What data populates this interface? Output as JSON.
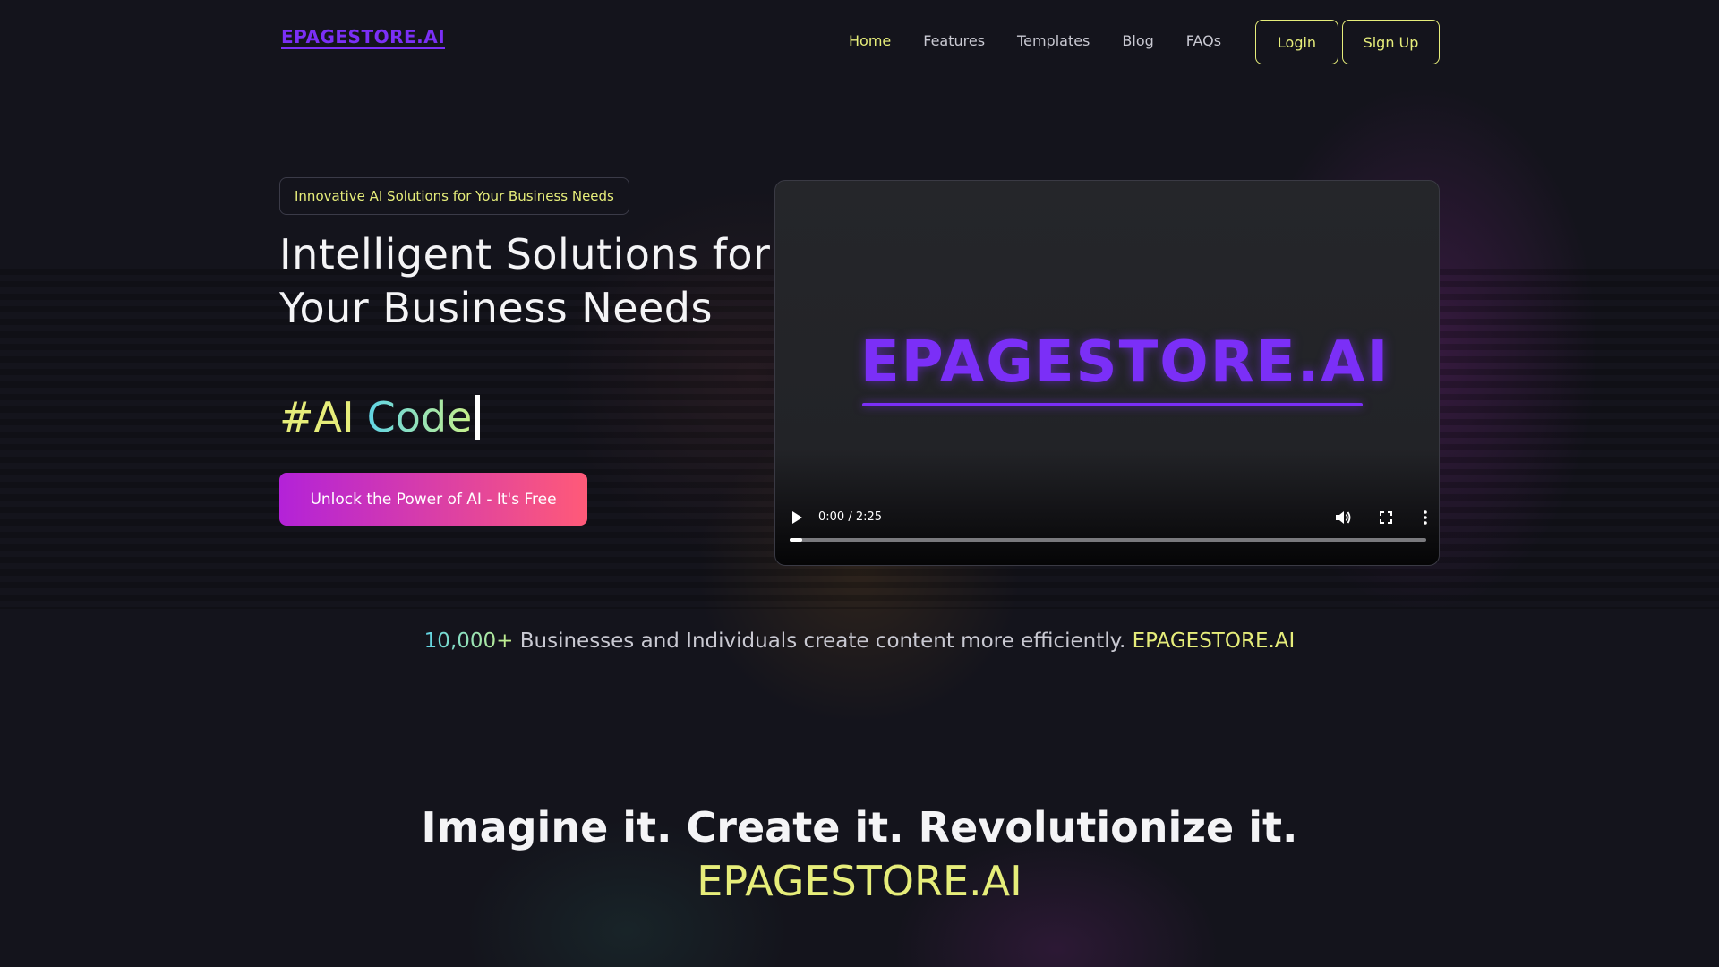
{
  "header": {
    "logo": "EPAGESTORE.AI",
    "nav": [
      {
        "label": "Home",
        "active": true
      },
      {
        "label": "Features",
        "active": false
      },
      {
        "label": "Templates",
        "active": false
      },
      {
        "label": "Blog",
        "active": false
      },
      {
        "label": "FAQs",
        "active": false
      }
    ],
    "login_label": "Login",
    "signup_label": "Sign Up"
  },
  "hero": {
    "tagline": "Innovative AI Solutions for Your Business Needs",
    "headline": "Intelligent Solutions for Your Business Needs",
    "typed_hash": "#AI",
    "typed_word": "Code",
    "cta_label": "Unlock the Power of AI - It's Free"
  },
  "video": {
    "logo_text": "EPAGESTORE.AI",
    "time": "0:00 / 2:25",
    "progress_fraction": 0.02
  },
  "stats": {
    "number": "10,000+",
    "text": " Businesses and Individuals create content more efficiently. ",
    "brand": "EPAGESTORE.AI"
  },
  "closing": {
    "headline": "Imagine it. Create it. Revolutionize it.",
    "brand": "EPAGESTORE.AI"
  },
  "colors": {
    "background": "#14141c",
    "accent_yellow": "#e6ed7a",
    "brand_purple": "#7b2ff7",
    "cta_start": "#b322d8",
    "cta_end": "#ff5a78"
  }
}
